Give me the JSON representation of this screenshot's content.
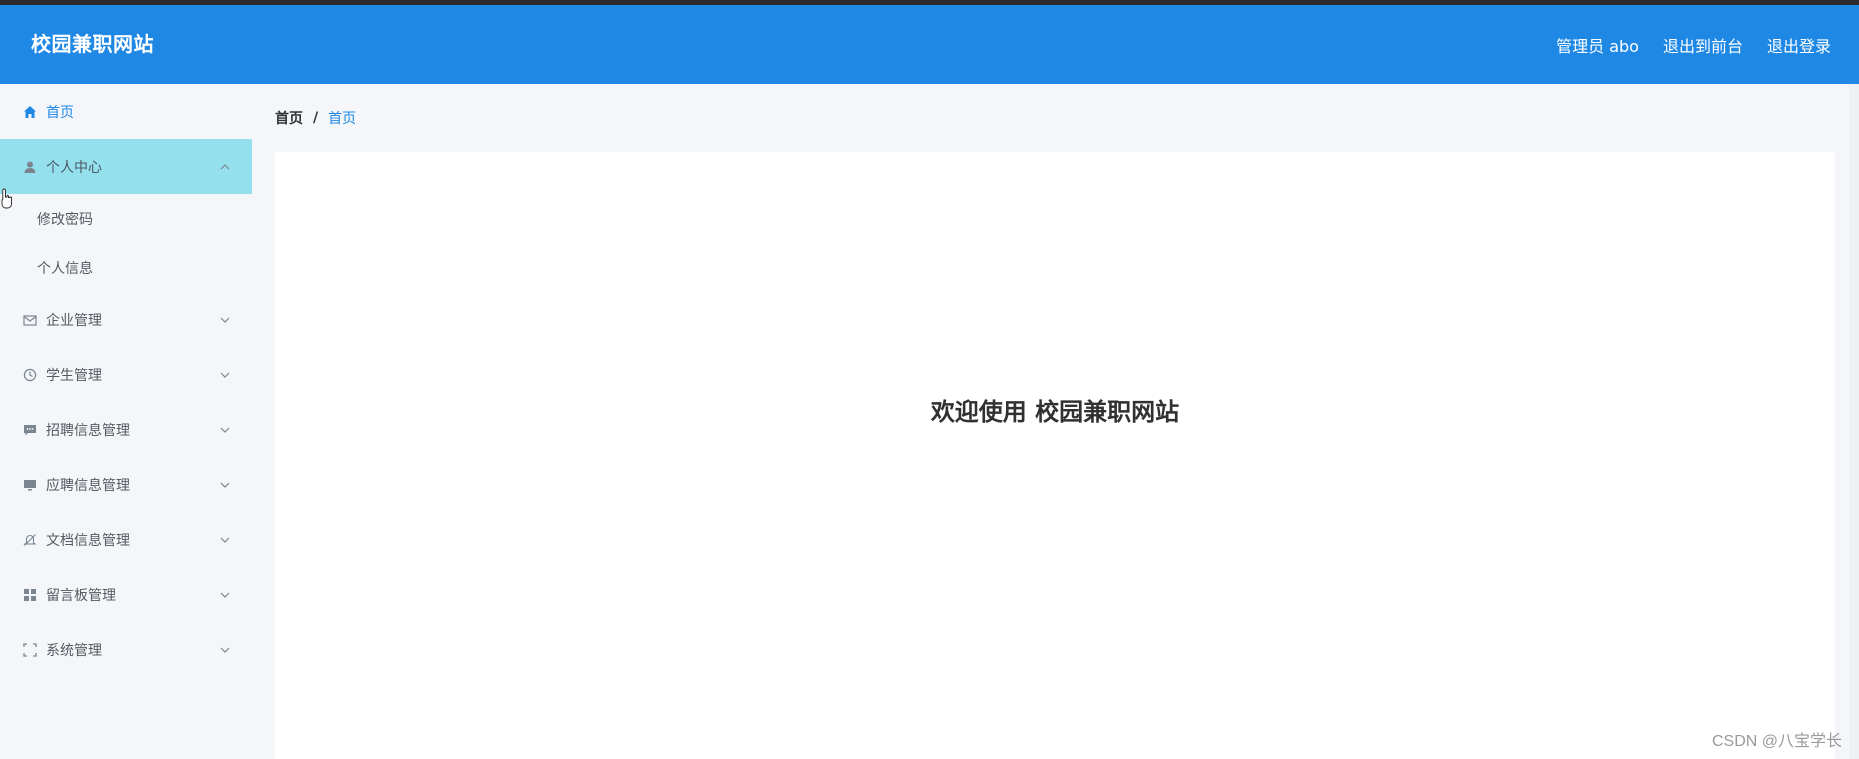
{
  "header": {
    "brand": "校园兼职网站",
    "user_label": "管理员 abo",
    "to_front_label": "退出到前台",
    "logout_label": "退出登录",
    "bg_color": "#1f88e5"
  },
  "sidebar": {
    "home": {
      "label": "首页",
      "icon": "home-icon"
    },
    "personal": {
      "label": "个人中心",
      "icon": "user-icon",
      "children": [
        {
          "label": "修改密码"
        },
        {
          "label": "个人信息"
        }
      ]
    },
    "items": [
      {
        "label": "企业管理",
        "icon": "mail-icon"
      },
      {
        "label": "学生管理",
        "icon": "clock-icon"
      },
      {
        "label": "招聘信息管理",
        "icon": "chat-icon"
      },
      {
        "label": "应聘信息管理",
        "icon": "monitor-icon"
      },
      {
        "label": "文档信息管理",
        "icon": "bell-off-icon"
      },
      {
        "label": "留言板管理",
        "icon": "grid-icon"
      },
      {
        "label": "系统管理",
        "icon": "fullscreen-icon"
      }
    ],
    "open_bg_color": "#94e0ec"
  },
  "breadcrumb": {
    "root": "首页",
    "separator": "/",
    "current": "首页"
  },
  "main": {
    "welcome": "欢迎使用 校园兼职网站"
  },
  "watermark": "CSDN @八宝学长"
}
